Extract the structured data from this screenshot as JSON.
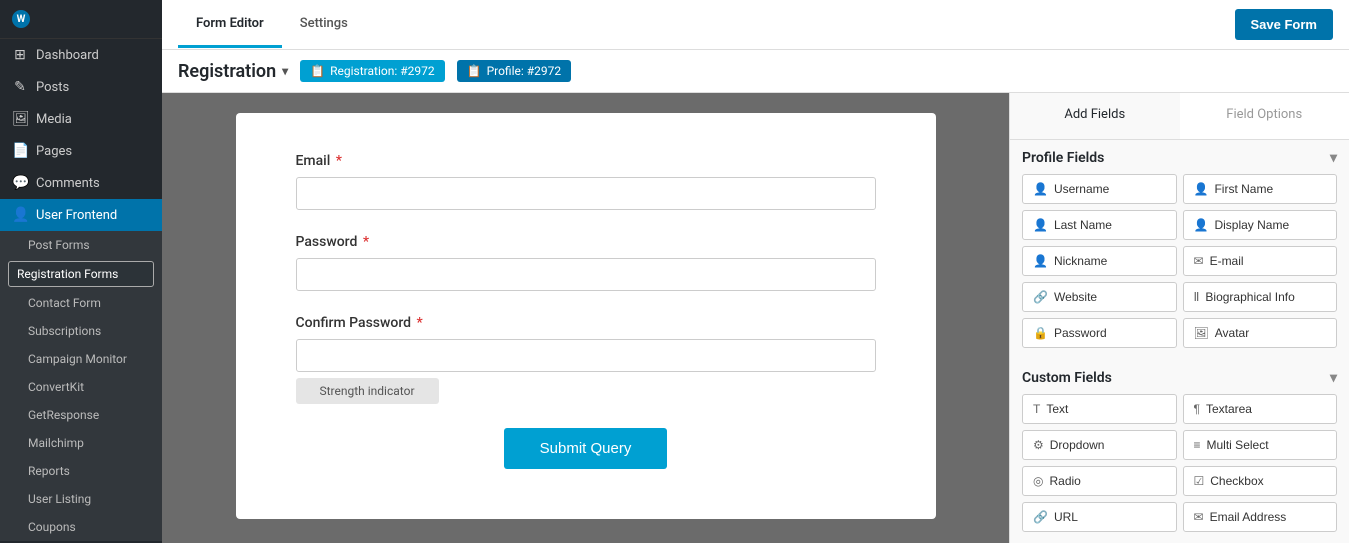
{
  "sidebar": {
    "logo_label": "WordPress",
    "items": [
      {
        "id": "dashboard",
        "label": "Dashboard",
        "icon": "⊞",
        "active": false
      },
      {
        "id": "posts",
        "label": "Posts",
        "icon": "✎",
        "active": false
      },
      {
        "id": "media",
        "label": "Media",
        "icon": "🖼",
        "active": false
      },
      {
        "id": "pages",
        "label": "Pages",
        "icon": "📄",
        "active": false
      },
      {
        "id": "comments",
        "label": "Comments",
        "icon": "💬",
        "active": false
      },
      {
        "id": "user-frontend",
        "label": "User Frontend",
        "icon": "👤",
        "active": true
      }
    ],
    "submenu": [
      {
        "id": "post-forms",
        "label": "Post Forms",
        "active": false
      },
      {
        "id": "registration-forms",
        "label": "Registration Forms",
        "active": true,
        "highlighted": true
      },
      {
        "id": "contact-form",
        "label": "Contact Form",
        "active": false
      },
      {
        "id": "subscriptions",
        "label": "Subscriptions",
        "active": false
      },
      {
        "id": "campaign-monitor",
        "label": "Campaign Monitor",
        "active": false
      },
      {
        "id": "convertkit",
        "label": "ConvertKit",
        "active": false
      },
      {
        "id": "getresponse",
        "label": "GetResponse",
        "active": false
      },
      {
        "id": "mailchimp",
        "label": "Mailchimp",
        "active": false
      },
      {
        "id": "reports",
        "label": "Reports",
        "active": false
      },
      {
        "id": "user-listing",
        "label": "User Listing",
        "active": false
      },
      {
        "id": "coupons",
        "label": "Coupons",
        "active": false
      }
    ]
  },
  "topbar": {
    "tabs": [
      {
        "id": "form-editor",
        "label": "Form Editor",
        "active": true
      },
      {
        "id": "settings",
        "label": "Settings",
        "active": false
      }
    ],
    "save_button": "Save Form"
  },
  "subheader": {
    "form_title": "Registration",
    "badges": [
      {
        "id": "registration-badge",
        "icon": "📋",
        "label": "Registration: #2972"
      },
      {
        "id": "profile-badge",
        "icon": "📋",
        "label": "Profile: #2972"
      }
    ]
  },
  "form": {
    "fields": [
      {
        "id": "email",
        "label": "Email",
        "required": true,
        "type": "text"
      },
      {
        "id": "password",
        "label": "Password",
        "required": true,
        "type": "password"
      },
      {
        "id": "confirm-password",
        "label": "Confirm Password",
        "required": true,
        "type": "password"
      }
    ],
    "strength_indicator": "Strength indicator",
    "submit_button": "Submit Query"
  },
  "right_panel": {
    "tabs": [
      {
        "id": "add-fields",
        "label": "Add Fields",
        "active": true
      },
      {
        "id": "field-options",
        "label": "Field Options",
        "active": false
      }
    ],
    "profile_fields": {
      "section_title": "Profile Fields",
      "fields": [
        {
          "id": "username",
          "label": "Username",
          "icon": "👤"
        },
        {
          "id": "first-name",
          "label": "First Name",
          "icon": "👤"
        },
        {
          "id": "last-name",
          "label": "Last Name",
          "icon": "👤"
        },
        {
          "id": "display-name",
          "label": "Display Name",
          "icon": "👤"
        },
        {
          "id": "nickname",
          "label": "Nickname",
          "icon": "👤"
        },
        {
          "id": "email",
          "label": "E-mail",
          "icon": "✉"
        },
        {
          "id": "website",
          "label": "Website",
          "icon": "🔗"
        },
        {
          "id": "biographical-info",
          "label": "Biographical Info",
          "icon": "Ⅱ"
        },
        {
          "id": "password",
          "label": "Password",
          "icon": "🔒"
        },
        {
          "id": "avatar",
          "label": "Avatar",
          "icon": "🖼"
        }
      ]
    },
    "custom_fields": {
      "section_title": "Custom Fields",
      "fields": [
        {
          "id": "text",
          "label": "Text",
          "icon": "T"
        },
        {
          "id": "textarea",
          "label": "Textarea",
          "icon": "¶"
        },
        {
          "id": "dropdown",
          "label": "Dropdown",
          "icon": "⚙"
        },
        {
          "id": "multi-select",
          "label": "Multi Select",
          "icon": "≡"
        },
        {
          "id": "radio",
          "label": "Radio",
          "icon": "◎"
        },
        {
          "id": "checkbox",
          "label": "Checkbox",
          "icon": "☑"
        },
        {
          "id": "url",
          "label": "URL",
          "icon": "🔗"
        },
        {
          "id": "email-address",
          "label": "Email Address",
          "icon": "✉"
        }
      ]
    }
  }
}
